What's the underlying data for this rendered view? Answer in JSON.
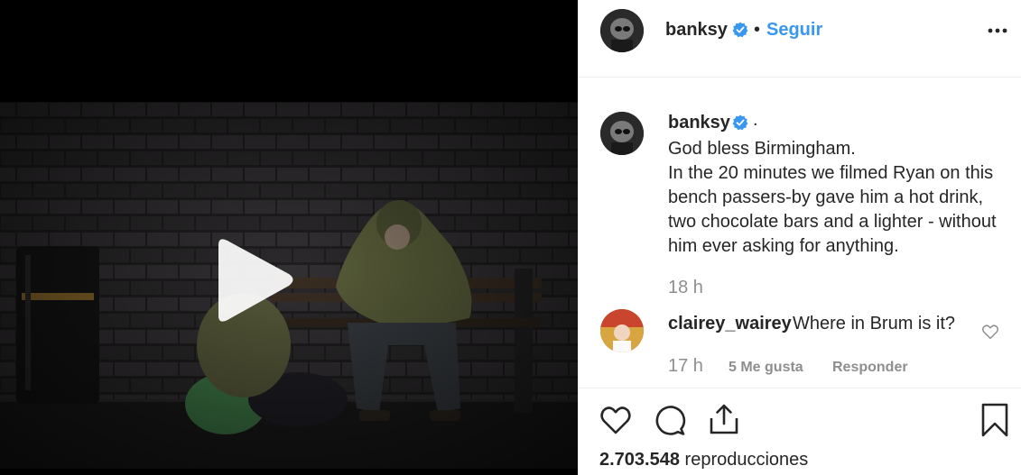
{
  "post": {
    "username": "banksy",
    "follow_label": "Seguir",
    "separator": "•",
    "caption": {
      "username": "banksy",
      "trailing": ".",
      "text": "God bless Birmingham.\nIn the 20 minutes we filmed Ryan on this bench passers-by gave him a hot drink, two chocolate bars and a lighter - without him ever asking for anything.",
      "time": "18 h"
    },
    "comment": {
      "username": "clairey_wairey",
      "text": "Where in Brum is it?",
      "time": "17 h",
      "likes_label": "5 Me gusta",
      "reply_label": "Responder"
    },
    "views": {
      "count": "2.703.548",
      "label": "reproducciones"
    }
  },
  "colors": {
    "link": "#3897f0",
    "verified": "#3897f0",
    "muted": "#8e8e8e",
    "text": "#262626"
  },
  "icons": {
    "verified": "verified-badge-icon",
    "more": "more-options-icon",
    "like": "heart-icon",
    "comment": "comment-icon",
    "share": "share-icon",
    "save": "bookmark-icon",
    "play": "play-icon"
  }
}
